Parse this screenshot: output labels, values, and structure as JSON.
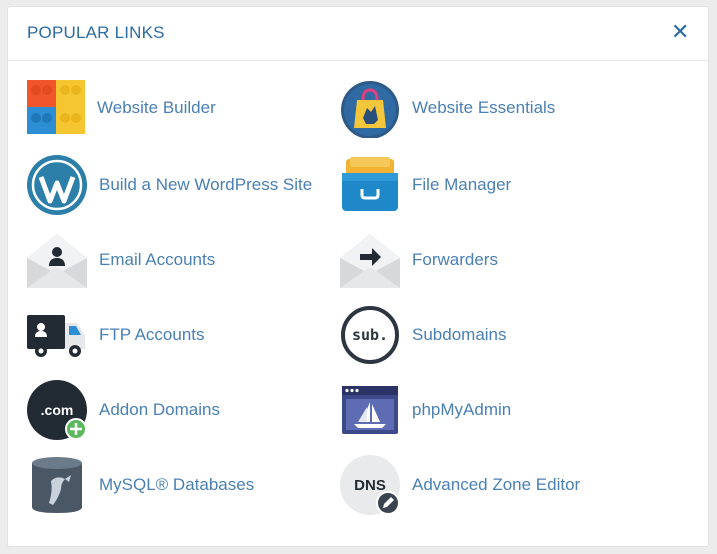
{
  "header": {
    "title": "POPULAR LINKS",
    "close_icon": "close-icon"
  },
  "colors": {
    "link_text": "#4a80b4",
    "title_text": "#2c6ca3"
  },
  "links": [
    {
      "label": "Website Builder",
      "icon": "website-builder-icon"
    },
    {
      "label": "Website Essentials",
      "icon": "website-essentials-icon"
    },
    {
      "label": "Build a New WordPress Site",
      "icon": "wordpress-icon"
    },
    {
      "label": "File Manager",
      "icon": "file-manager-icon"
    },
    {
      "label": "Email Accounts",
      "icon": "email-accounts-icon"
    },
    {
      "label": "Forwarders",
      "icon": "forwarders-icon"
    },
    {
      "label": "FTP Accounts",
      "icon": "ftp-truck-icon"
    },
    {
      "label": "Subdomains",
      "icon": "subdomains-icon",
      "icon_text": "sub."
    },
    {
      "label": "Addon Domains",
      "icon": "addon-domains-icon",
      "icon_text": ".com"
    },
    {
      "label": "phpMyAdmin",
      "icon": "phpmyadmin-icon"
    },
    {
      "label": "MySQL® Databases",
      "icon": "mysql-databases-icon"
    },
    {
      "label": "Advanced Zone Editor",
      "icon": "zone-editor-icon",
      "icon_text": "DNS"
    }
  ]
}
